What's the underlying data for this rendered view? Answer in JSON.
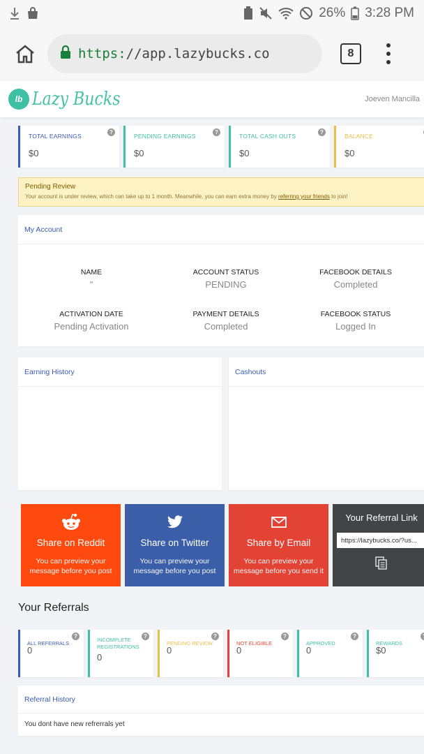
{
  "status_bar": {
    "battery": "26%",
    "time": "3:28 PM"
  },
  "browser": {
    "url_scheme": "https:",
    "url_rest": "//app.lazybucks.co",
    "tab_count": "8"
  },
  "site": {
    "logo_text": "Lazy Bucks",
    "username": "Joeven Mancilla"
  },
  "stats": [
    {
      "label": "TOTAL EARNINGS",
      "value": "$0",
      "color": "#3b5bb5"
    },
    {
      "label": "PENDING EARNINGS",
      "value": "$0",
      "color": "#3fc0a4"
    },
    {
      "label": "TOTAL CASH OUTS",
      "value": "$0",
      "color": "#3fc0a4"
    },
    {
      "label": "BALANCE",
      "value": "$0",
      "color": "#e8c14a"
    }
  ],
  "alert": {
    "title": "Pending Review",
    "message": "Your account is under review, which can take up to 1 month. Meanwhile, you can earn extra money by",
    "link": "referring your friends",
    "suffix": "to join!"
  },
  "account": {
    "title": "My Account",
    "fields": [
      {
        "key": "NAME",
        "value": "\""
      },
      {
        "key": "ACCOUNT STATUS",
        "value": "PENDING"
      },
      {
        "key": "FACEBOOK DETAILS",
        "value": "Completed"
      },
      {
        "key": "ACTIVATION DATE",
        "value": "Pending Activation"
      },
      {
        "key": "PAYMENT DETAILS",
        "value": "Completed"
      },
      {
        "key": "FACEBOOK STATUS",
        "value": "Logged In"
      }
    ]
  },
  "earning_history": {
    "title": "Earning History"
  },
  "cashouts": {
    "title": "Cashouts"
  },
  "share": {
    "reddit": {
      "title": "Share on Reddit",
      "desc": "You can preview your message before you post"
    },
    "twitter": {
      "title": "Share on Twitter",
      "desc": "You can preview your message before you post"
    },
    "email": {
      "title": "Share by Email",
      "desc": "You can preview your message before you send it"
    },
    "referral": {
      "title": "Your Referral Link",
      "url": "https://lazybucks.co/?us..."
    }
  },
  "referrals": {
    "title": "Your Referrals",
    "cards": [
      {
        "label": "ALL REFERRALS",
        "value": "0",
        "color": "#3b5bb5"
      },
      {
        "label": "INCOMPLETE REGISTRATIONS",
        "value": "0",
        "color": "#3fc0a4"
      },
      {
        "label": "PENDING REVIEW",
        "value": "0",
        "color": "#e8c14a"
      },
      {
        "label": "NOT ELIGIBLE",
        "value": "0",
        "color": "#e24335"
      },
      {
        "label": "APPROVED",
        "value": "0",
        "color": "#3fc0a4"
      },
      {
        "label": "REWARDS",
        "value": "$0",
        "color": "#3fc0a4"
      }
    ],
    "history_title": "Referral History",
    "history_empty": "You dont have new refrerrals yet"
  }
}
